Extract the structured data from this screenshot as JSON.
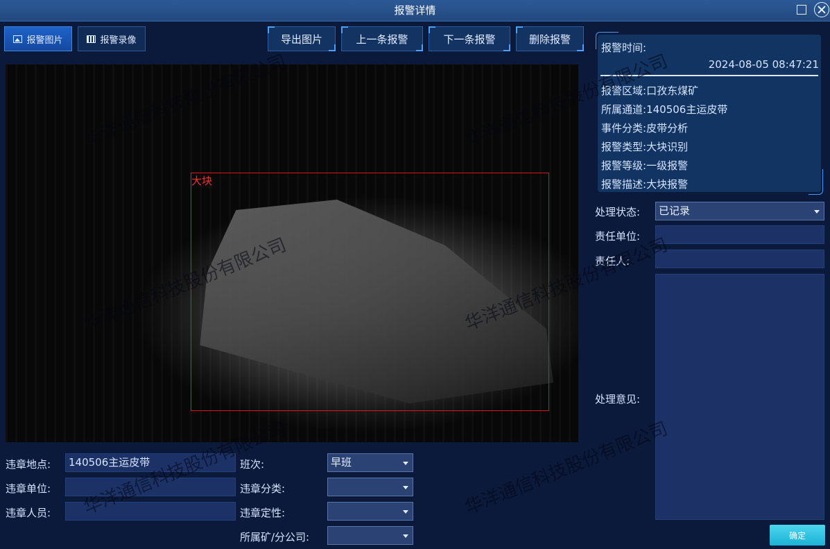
{
  "window": {
    "title": "报警详情",
    "controls": [
      "maximize-icon",
      "close-icon"
    ]
  },
  "tabs": [
    {
      "label": "报警图片",
      "icon": "image-icon",
      "active": true
    },
    {
      "label": "报警录像",
      "icon": "video-icon",
      "active": false
    }
  ],
  "toolbar": {
    "export": "导出图片",
    "prev": "上一条报警",
    "next": "下一条报警",
    "delete": "删除报警"
  },
  "image": {
    "box_label": "大块",
    "box_color": "#e0141a"
  },
  "watermark": "华洋通信科技股份有限公司",
  "violation": {
    "location_label": "违章地点:",
    "location_value": "140506主运皮带",
    "unit_label": "违章单位:",
    "unit_value": "",
    "person_label": "违章人员:",
    "person_value": "",
    "shift_label": "班次:",
    "shift_value": "早班",
    "category_label": "违章分类:",
    "category_value": "",
    "nature_label": "违章定性:",
    "nature_value": "",
    "branch_label": "所属矿/分公司:",
    "branch_value": ""
  },
  "alarm": {
    "time_label": "报警时间:",
    "time_value": "2024-08-05 08:47:21",
    "rows": [
      {
        "label": "报警区域:",
        "value": "口孜东煤矿"
      },
      {
        "label": "所属通道:",
        "value": "140506主运皮带"
      },
      {
        "label": "事件分类:",
        "value": "皮带分析"
      },
      {
        "label": "报警类型:",
        "value": "大块识别"
      },
      {
        "label": "报警等级:",
        "value": "一级报警"
      },
      {
        "label": "报警描述:",
        "value": "大块报警"
      }
    ]
  },
  "handling": {
    "status_label": "处理状态:",
    "status_value": "已记录",
    "unit_label": "责任单位:",
    "unit_value": "",
    "person_label": "责任人:",
    "person_value": "",
    "opinion_label": "处理意见:",
    "opinion_value": ""
  },
  "confirm_label": "确定",
  "colors": {
    "accent": "#1549a0",
    "confirm": "#1cb2d6",
    "background": "#0b1a3b"
  }
}
